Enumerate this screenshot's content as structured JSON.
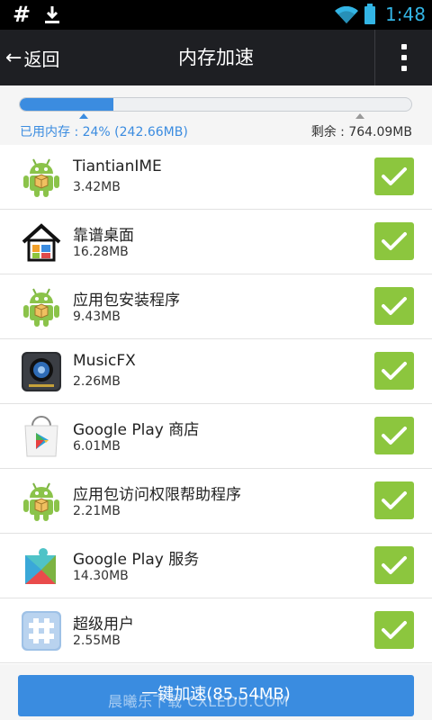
{
  "statusbar": {
    "time": "1:48",
    "hash": "#"
  },
  "header": {
    "back_label": "返回",
    "title": "内存加速"
  },
  "memory": {
    "used_label": "已用内存 : 24% (242.66MB)",
    "remain_label": "剩余 : 764.09MB",
    "used_percent": 24
  },
  "apps": [
    {
      "name": "TiantianIME",
      "size": "3.42MB",
      "icon": "android-icon",
      "checked": true
    },
    {
      "name": "靠谱桌面",
      "size": "16.28MB",
      "icon": "home-launcher-icon",
      "checked": true
    },
    {
      "name": "应用包安装程序",
      "size": "9.43MB",
      "icon": "android-icon",
      "checked": true
    },
    {
      "name": "MusicFX",
      "size": "2.26MB",
      "icon": "speaker-icon",
      "checked": true
    },
    {
      "name": "Google Play 商店",
      "size": "6.01MB",
      "icon": "play-store-icon",
      "checked": true
    },
    {
      "name": "应用包访问权限帮助程序",
      "size": "2.21MB",
      "icon": "android-icon",
      "checked": true
    },
    {
      "name": "Google Play 服务",
      "size": "14.30MB",
      "icon": "puzzle-icon",
      "checked": true
    },
    {
      "name": "超级用户",
      "size": "2.55MB",
      "icon": "hash-icon",
      "checked": true
    }
  ],
  "action": {
    "label": "一键加速(85.54MB)"
  },
  "watermark": "晨曦乐下载 CXLEDU.COM",
  "colors": {
    "accent": "#3a8ce0",
    "check": "#8cc63e",
    "titlebar": "#1e1f23"
  }
}
